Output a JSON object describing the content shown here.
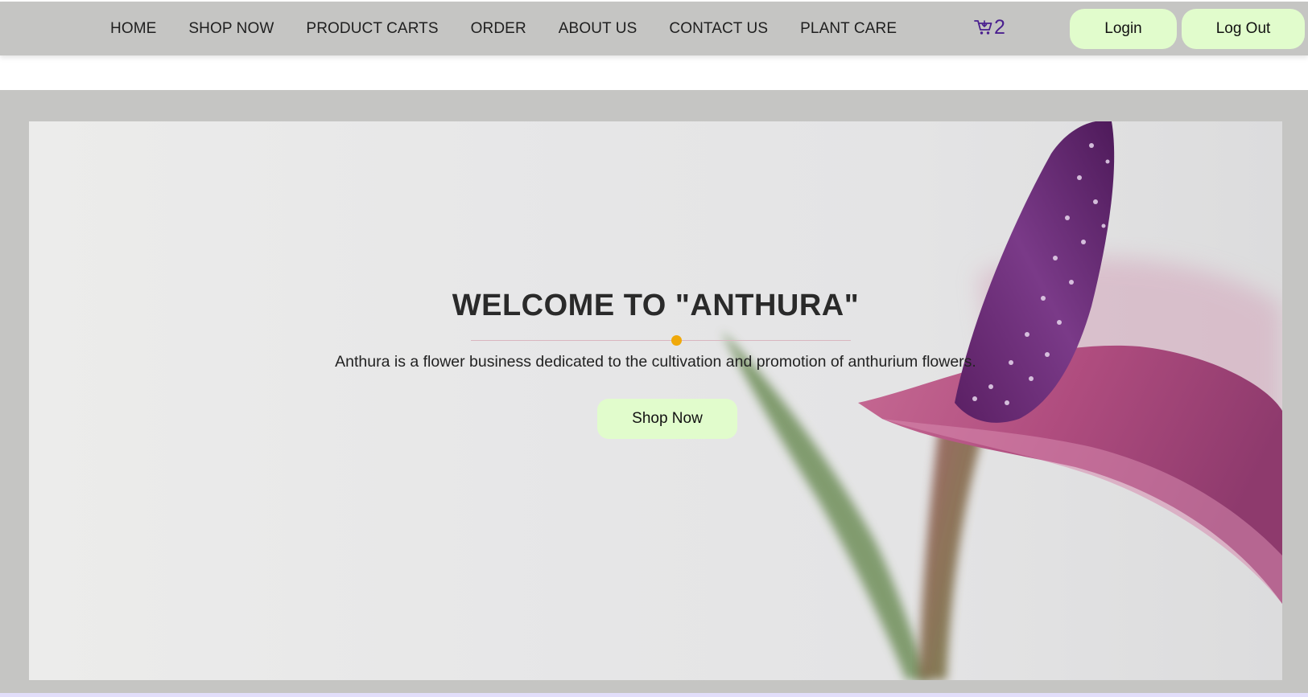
{
  "nav": {
    "links": [
      {
        "label": "HOME"
      },
      {
        "label": "SHOP NOW"
      },
      {
        "label": "PRODUCT CARTS"
      },
      {
        "label": "ORDER"
      },
      {
        "label": "ABOUT US"
      },
      {
        "label": "CONTACT US"
      },
      {
        "label": "PLANT CARE"
      }
    ],
    "cart": {
      "icon": "cart-icon",
      "count": "2"
    },
    "login_label": "Login",
    "logout_label": "Log Out"
  },
  "hero": {
    "title": "WELCOME TO \"ANTHURA\"",
    "subtitle": "Anthura is a flower business dedicated to the cultivation and promotion of anthurium flowers.",
    "cta_label": "Shop Now",
    "image": "anthurium-flower-photo"
  },
  "colors": {
    "navbar_bg": "#c5c5c3",
    "button_bg": "#e1fccc",
    "cart_color": "#4a1f8f",
    "divider_dot": "#f0a90a",
    "flower_spadix": "#6b2a7a",
    "flower_spathe": "#b5527f"
  }
}
